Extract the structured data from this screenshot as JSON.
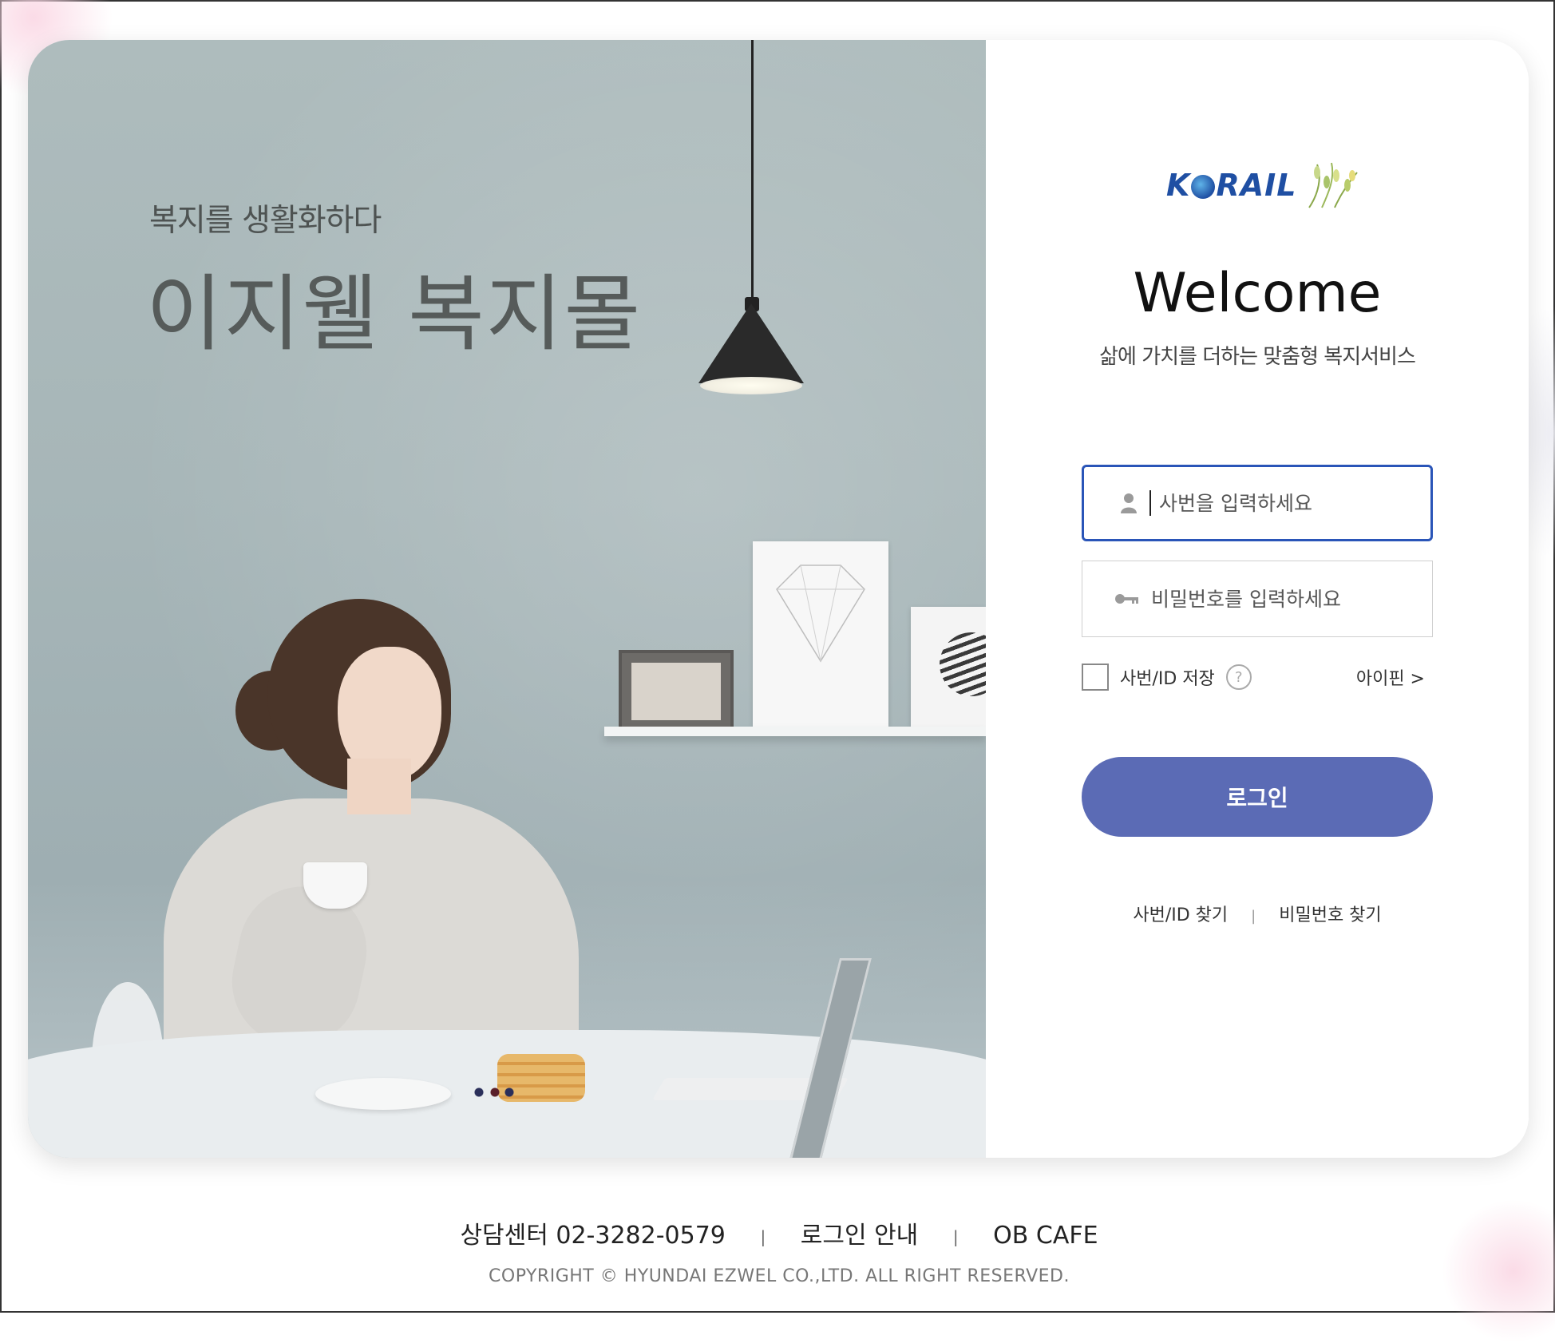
{
  "hero": {
    "tagline": "복지를 생활화하다",
    "brand": "이지웰 복지몰"
  },
  "login": {
    "logo_text_k": "K",
    "logo_text_rest": "RAIL",
    "welcome": "Welcome",
    "subtitle": "삶에 가치를 더하는 맞춤형 복지서비스",
    "id_placeholder": "사번을 입력하세요",
    "pw_placeholder": "비밀번호를 입력하세요",
    "save_label": "사번/ID 저장",
    "help_symbol": "?",
    "ipin_label": "아이핀 >",
    "login_button": "로그인",
    "find_id": "사번/ID 찾기",
    "find_pw": "비밀번호 찾기",
    "find_separator": "|"
  },
  "footer": {
    "contact": "상담센터 02-3282-0579",
    "login_guide": "로그인 안내",
    "ob_cafe": "OB CAFE",
    "separator": "|",
    "copyright": "COPYRIGHT © HYUNDAI EZWEL CO.,LTD. ALL RIGHT RESERVED."
  },
  "colors": {
    "accent": "#5b6bb5",
    "focus_border": "#2a55b8",
    "logo_blue": "#1f4fa3"
  },
  "icons": {
    "id_field": "user-icon",
    "pw_field": "key-icon",
    "help": "question-circle-icon",
    "logo_decoration": "leaf-icon"
  }
}
